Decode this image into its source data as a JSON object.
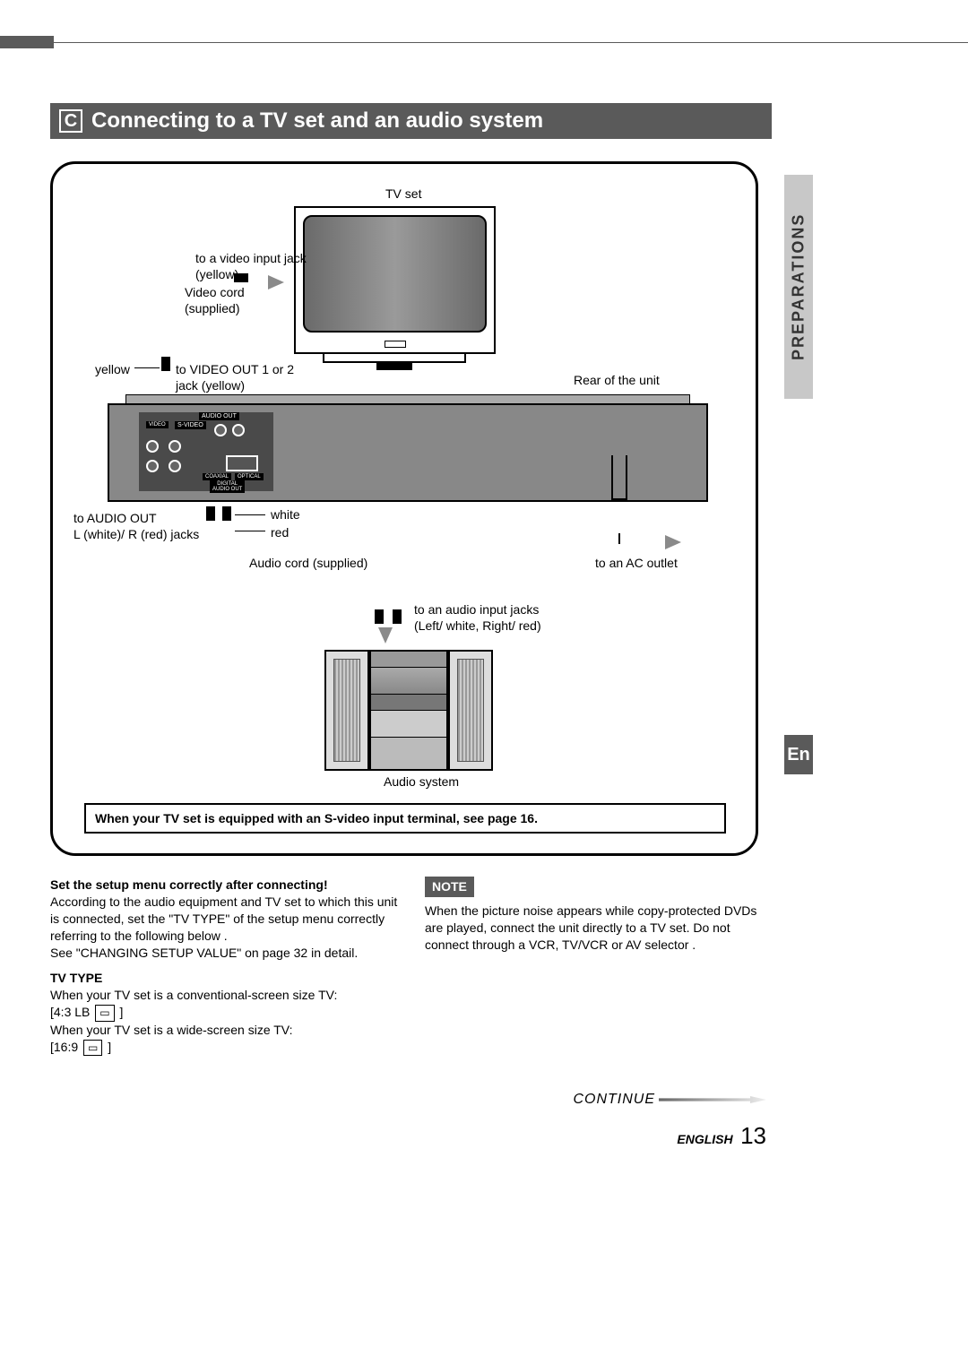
{
  "heading": {
    "letter": "C",
    "title": "Connecting to a TV set and an audio system"
  },
  "sideTab": "PREPARATIONS",
  "enTab": "En",
  "diagram": {
    "tvset": "TV set",
    "videoInputJack": "to a video input jack\n(yellow)",
    "videoCord": "Video cord\n(supplied)",
    "yellow": "yellow",
    "videoOut": "to VIDEO OUT 1 or 2\njack (yellow)",
    "rearUnit": "Rear of the unit",
    "audioOut": "to AUDIO OUT\nL (white)/ R (red) jacks",
    "white": "white",
    "red": "red",
    "audioCord": "Audio cord (supplied)",
    "acOutlet": "to an AC outlet",
    "audioInputJacks": "to an audio input jacks\n(Left/ white, Right/ red)",
    "audioSystem": "Audio system",
    "panelLabels": {
      "audioOutBar": "AUDIO OUT",
      "svideo": "S-VIDEO",
      "video": "VIDEO",
      "coaxial": "COAXIAL",
      "optical": "OPTICAL",
      "digitalAudioOut": "DIGITAL\nAUDIO OUT"
    }
  },
  "noteBox": "When your TV set is equipped with an S-video input terminal, see page 16.",
  "leftCol": {
    "h1": "Set the setup menu correctly after connecting!",
    "p1": "According to the audio equipment and TV set to which this unit is connected, set the \"TV TYPE\" of the setup menu correctly referring to the following below        .",
    "p2": "See  \"CHANGING SETUP  VALUE\" on page 32 in detail.",
    "tvType": "TV TYPE",
    "conv": "When your TV set is a conventional-screen size TV:",
    "ratio43": "[4:3 LB",
    "wide": "When your TV set is a wide-screen size TV:",
    "ratio169": "[16:9",
    "bracketClose": "]"
  },
  "rightCol": {
    "noteLabel": "NOTE",
    "noteText": "When the picture noise appears while copy-protected DVDs are played, connect the unit directly to a TV set. Do not connect through a VCR, TV/VCR or    AV selector ."
  },
  "footer": {
    "continue": "CONTINUE",
    "lang": "ENGLISH",
    "page": "13"
  }
}
